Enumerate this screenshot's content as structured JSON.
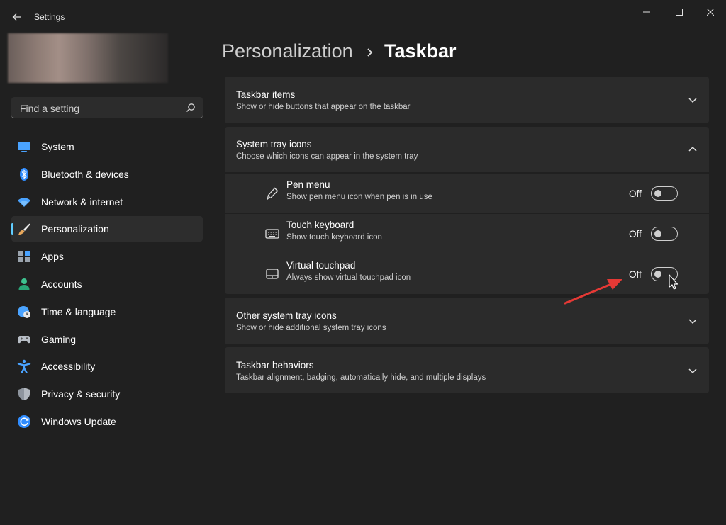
{
  "window": {
    "app_title": "Settings",
    "icons": {
      "back": "back-arrow-icon",
      "minimize": "minimize-icon",
      "maximize": "maximize-icon",
      "close": "close-icon"
    }
  },
  "search": {
    "placeholder": "Find a setting",
    "value": ""
  },
  "sidebar": {
    "items": [
      {
        "label": "System",
        "icon": "system-display-icon",
        "active": false
      },
      {
        "label": "Bluetooth & devices",
        "icon": "bluetooth-icon",
        "active": false
      },
      {
        "label": "Network & internet",
        "icon": "wifi-icon",
        "active": false
      },
      {
        "label": "Personalization",
        "icon": "brush-icon",
        "active": true
      },
      {
        "label": "Apps",
        "icon": "apps-icon",
        "active": false
      },
      {
        "label": "Accounts",
        "icon": "person-icon",
        "active": false
      },
      {
        "label": "Time & language",
        "icon": "globe-clock-icon",
        "active": false
      },
      {
        "label": "Gaming",
        "icon": "gamepad-icon",
        "active": false
      },
      {
        "label": "Accessibility",
        "icon": "accessibility-icon",
        "active": false
      },
      {
        "label": "Privacy & security",
        "icon": "shield-icon",
        "active": false
      },
      {
        "label": "Windows Update",
        "icon": "update-icon",
        "active": false
      }
    ]
  },
  "breadcrumb": {
    "parent": "Personalization",
    "current": "Taskbar"
  },
  "sections": {
    "taskbar_items": {
      "title": "Taskbar items",
      "subtitle": "Show or hide buttons that appear on the taskbar"
    },
    "system_tray_icons": {
      "title": "System tray icons",
      "subtitle": "Choose which icons can appear in the system tray",
      "items": [
        {
          "title": "Pen menu",
          "desc": "Show pen menu icon when pen is in use",
          "state": "Off",
          "icon": "pen-icon"
        },
        {
          "title": "Touch keyboard",
          "desc": "Show touch keyboard icon",
          "state": "Off",
          "icon": "keyboard-icon"
        },
        {
          "title": "Virtual touchpad",
          "desc": "Always show virtual touchpad icon",
          "state": "Off",
          "icon": "touchpad-icon"
        }
      ]
    },
    "other_tray_icons": {
      "title": "Other system tray icons",
      "subtitle": "Show or hide additional system tray icons"
    },
    "taskbar_behaviors": {
      "title": "Taskbar behaviors",
      "subtitle": "Taskbar alignment, badging, automatically hide, and multiple displays"
    }
  },
  "colors": {
    "background": "#202020",
    "card": "#2b2b2b",
    "accent": "#60cdff",
    "annotation_arrow": "#e53935"
  }
}
